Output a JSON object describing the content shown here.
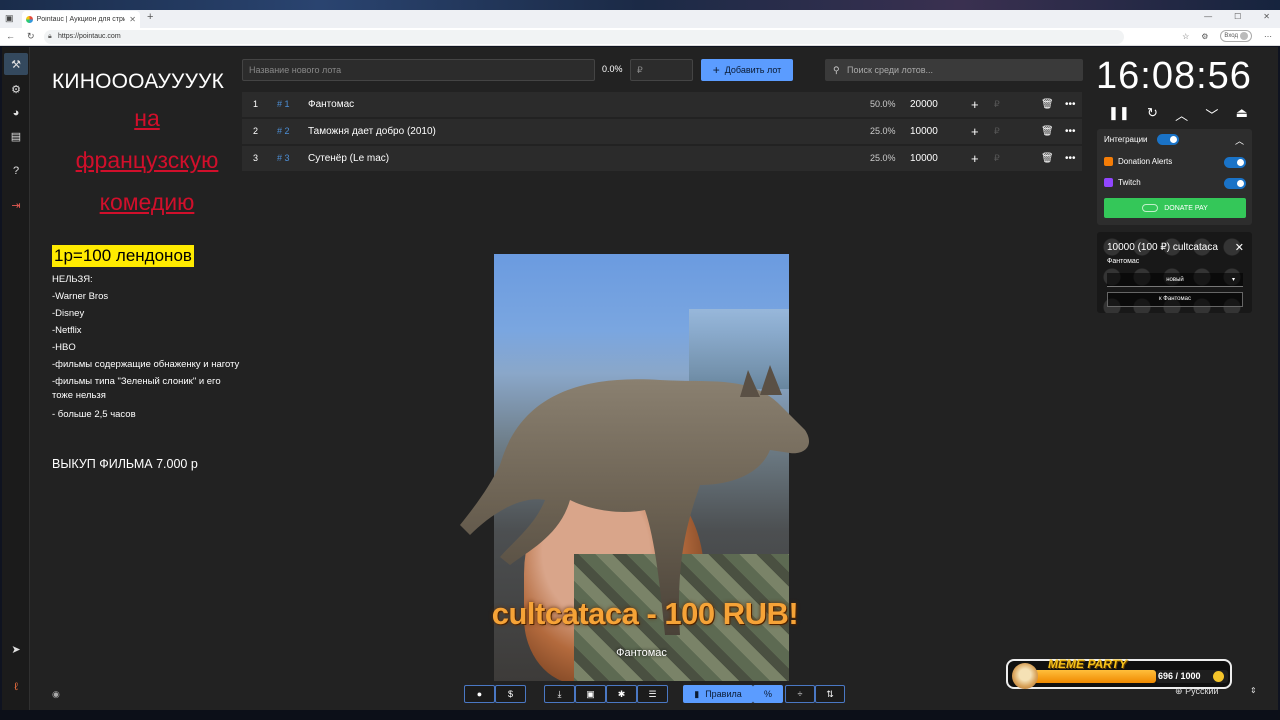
{
  "browser": {
    "tab_title": "Pointauc | Аукцион для стримера",
    "url": "https://pointauc.com",
    "profile_label": "Вход"
  },
  "sidebar": {
    "icons": [
      "gavel-icon",
      "gear-icon",
      "pie-chart-icon",
      "clipboard-icon",
      "help-icon",
      "logout-icon",
      "telegram-icon",
      "brand-icon"
    ]
  },
  "rules": {
    "heading": "КИНОООАУУУУК",
    "red_lines": [
      "на",
      "французскую",
      "комедию"
    ],
    "rate": "1р=100 лендонов",
    "forbidden_title": "НЕЛЬЗЯ:",
    "forbidden": [
      "-Warner Bros",
      "-Disney",
      "-Netflix",
      "-HBO",
      "-фильмы содержащие обнаженку и наготу",
      "-фильмы типа \"Зеленый слоник\" и его тоже нельзя",
      "- больше 2,5 часов"
    ],
    "buyout": "ВЫКУП ФИЛЬМА 7.000 р"
  },
  "controls": {
    "lot_placeholder": "Название нового лота",
    "percent": "0.0%",
    "amount_placeholder": "₽",
    "add_label": "Добавить лот",
    "search_placeholder": "Поиск среди лотов..."
  },
  "lots": [
    {
      "num": "1",
      "id": "# 1",
      "name": "Фантомас",
      "pct": "50.0%",
      "amount": "20000"
    },
    {
      "num": "2",
      "id": "# 2",
      "name": "Таможня дает добро (2010)",
      "pct": "25.0%",
      "amount": "10000"
    },
    {
      "num": "3",
      "id": "# 3",
      "name": "Сутенёр (Le mac)",
      "pct": "25.0%",
      "amount": "10000"
    }
  ],
  "timer": {
    "value": "16:08:56"
  },
  "integrations": {
    "title": "Интеграции",
    "items": [
      {
        "name": "Donation Alerts",
        "enabled": true,
        "color": "#f57d07"
      },
      {
        "name": "Twitch",
        "enabled": true,
        "color": "#9146ff"
      }
    ],
    "donate_label": "DONATE PAY"
  },
  "donation": {
    "title": "10000 (100 ₽) cultcataca",
    "message": "Фантомас",
    "select_value": "новый",
    "button_label": "к Фантомас"
  },
  "stream": {
    "alert_text": "cultcataca - 100 RUB!",
    "alert_sub": "Фантомас"
  },
  "toolbar": {
    "rules_label": "Правила",
    "percent_symbol": "%"
  },
  "meme": {
    "title": "MEME PARTY",
    "progress": "696 / 1000",
    "fraction": 0.696
  },
  "language": "Русский",
  "colors": {
    "accent": "#5b9cff",
    "id_blue": "#4d8fd6",
    "rule_red": "#d10f2b",
    "highlight": "#ffeb00",
    "donate_green": "#34c759"
  }
}
